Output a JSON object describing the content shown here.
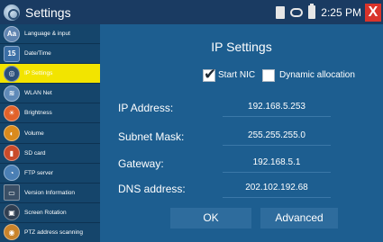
{
  "statusbar": {
    "title": "Settings",
    "time": "2:25 PM",
    "close_glyph": "X"
  },
  "sidebar": {
    "items": [
      {
        "label": "Language & input",
        "icon": "language-icon",
        "glyph": "Aa",
        "color": "#5f84b0",
        "active": false
      },
      {
        "label": "Date/Time",
        "icon": "calendar-icon",
        "glyph": "15",
        "color": "#3b6fa6",
        "active": false
      },
      {
        "label": "IP Settings",
        "icon": "globe-icon",
        "glyph": "◎",
        "color": "#2b4f7a",
        "active": true
      },
      {
        "label": "WLAN Net",
        "icon": "wifi-icon",
        "glyph": "≋",
        "color": "#5f8ab8",
        "active": false
      },
      {
        "label": "Brightness",
        "icon": "brightness-icon",
        "glyph": "☀",
        "color": "#e2622a",
        "active": false
      },
      {
        "label": "Volume",
        "icon": "volume-icon",
        "glyph": "◐",
        "color": "#d98a1d",
        "active": false
      },
      {
        "label": "SD card",
        "icon": "sd-card-icon",
        "glyph": "▮",
        "color": "#c94b2a",
        "active": false
      },
      {
        "label": "FTP server",
        "icon": "ftp-icon",
        "glyph": "◔",
        "color": "#4a7fb5",
        "active": false
      },
      {
        "label": "Version Information",
        "icon": "monitor-icon",
        "glyph": "▭",
        "color": "#3a4f66",
        "active": false
      },
      {
        "label": "Screen Rotation",
        "icon": "rotation-icon",
        "glyph": "▣",
        "color": "#2f3f52",
        "active": false
      },
      {
        "label": "PTZ address scanning",
        "icon": "ptz-icon",
        "glyph": "◉",
        "color": "#c9832a",
        "active": false
      }
    ]
  },
  "main": {
    "title": "IP Settings",
    "start_nic": {
      "label": "Start NIC",
      "checked": true
    },
    "dynamic_allocation": {
      "label": "Dynamic allocation",
      "checked": false
    },
    "fields": {
      "ip_address": {
        "label": "IP Address:",
        "value": "192.168.5.253"
      },
      "subnet_mask": {
        "label": "Subnet Mask:",
        "value": "255.255.255.0"
      },
      "gateway": {
        "label": "Gateway:",
        "value": "192.168.5.1"
      },
      "dns": {
        "label": "DNS address:",
        "value": "202.102.192.68"
      }
    },
    "ok_label": "OK",
    "advanced_label": "Advanced"
  }
}
